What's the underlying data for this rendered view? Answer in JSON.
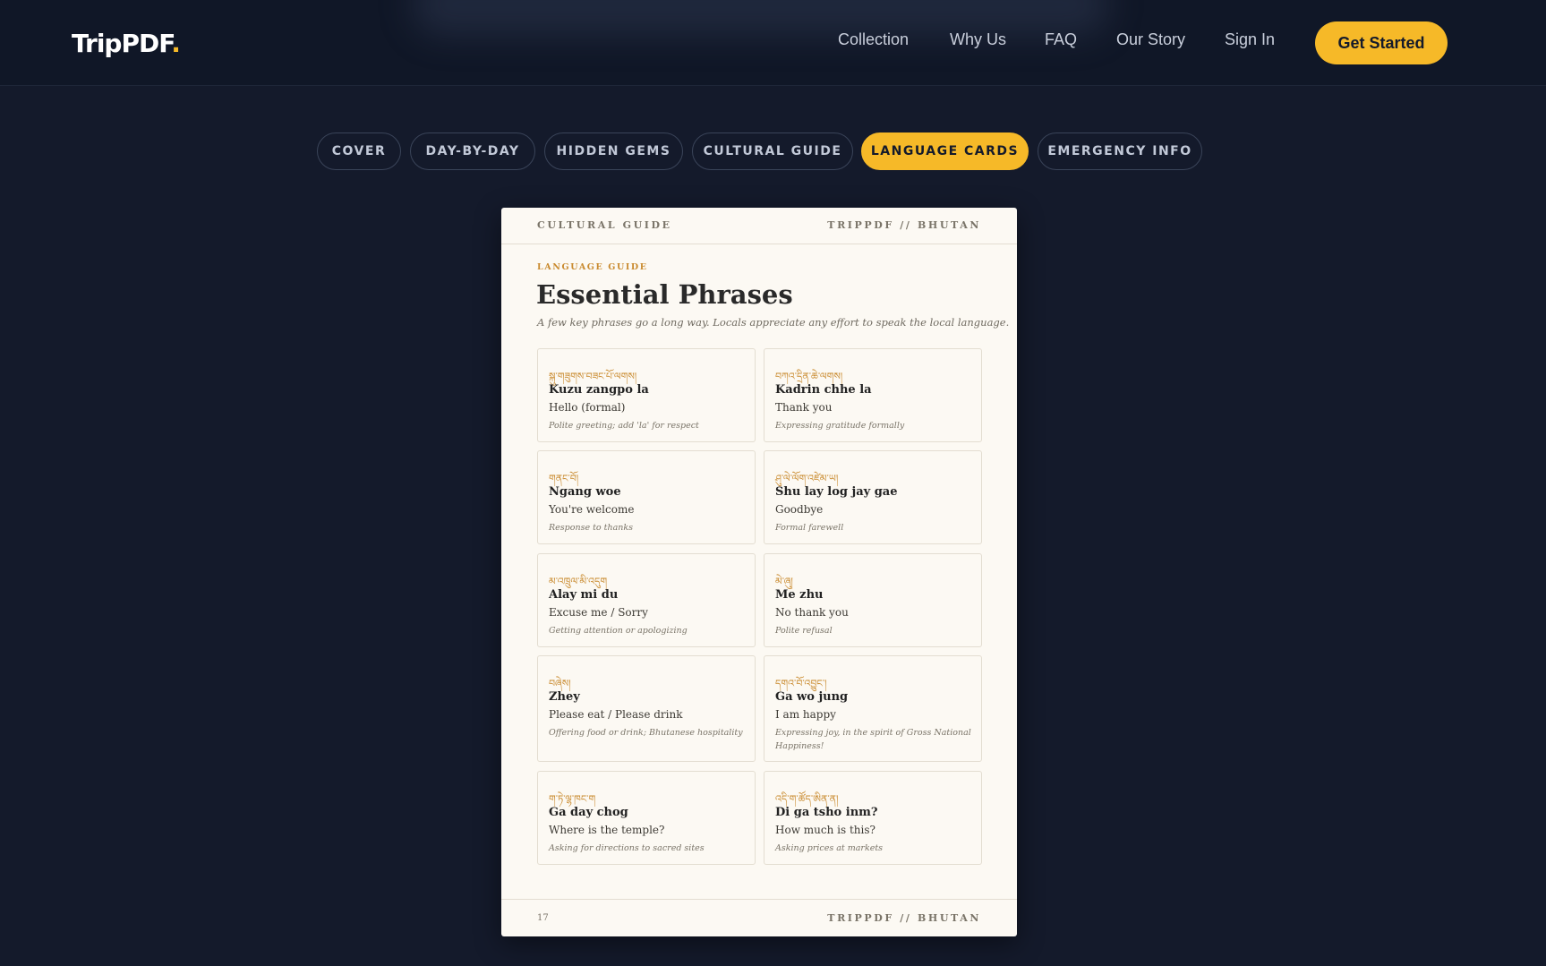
{
  "brand": {
    "name": "TripPDF",
    "dot": "."
  },
  "nav": {
    "links": [
      "Collection",
      "Why Us",
      "FAQ",
      "Our Story",
      "Sign In"
    ],
    "cta": "Get Started"
  },
  "tabs": [
    {
      "label": "COVER",
      "active": false
    },
    {
      "label": "DAY-BY-DAY",
      "active": false
    },
    {
      "label": "HIDDEN GEMS",
      "active": false
    },
    {
      "label": "CULTURAL GUIDE",
      "active": false
    },
    {
      "label": "LANGUAGE CARDS",
      "active": true
    },
    {
      "label": "EMERGENCY INFO",
      "active": false
    }
  ],
  "page": {
    "header_left": "CULTURAL GUIDE",
    "header_right": "TRIPPDF // BHUTAN",
    "eyebrow": "LANGUAGE GUIDE",
    "title": "Essential Phrases",
    "subtitle": "A few key phrases go a long way. Locals appreciate any effort to speak the local language.",
    "phrases": [
      {
        "dzongkha": "སྐུ་གཟུགས་བཟང་པོ་ལགས།",
        "roman": "Kuzu zangpo la",
        "meaning": "Hello (formal)",
        "note": "Polite greeting; add 'la' for respect"
      },
      {
        "dzongkha": "བཀའ་དྲིན་ཆེ་ལགས།",
        "roman": "Kadrin chhe la",
        "meaning": "Thank you",
        "note": "Expressing gratitude formally"
      },
      {
        "dzongkha": "གནང་བོ།",
        "roman": "Ngang woe",
        "meaning": "You're welcome",
        "note": "Response to thanks"
      },
      {
        "dzongkha": "ཤུ་ལེ་ལོག་འཛེམ་ཡ།",
        "roman": "Shu lay log jay gae",
        "meaning": "Goodbye",
        "note": "Formal farewell"
      },
      {
        "dzongkha": "མ་འཁྲུལ་མི་འདུག",
        "roman": "Alay mi du",
        "meaning": "Excuse me / Sorry",
        "note": "Getting attention or apologizing"
      },
      {
        "dzongkha": "མེ་ཞུ།",
        "roman": "Me zhu",
        "meaning": "No thank you",
        "note": "Polite refusal"
      },
      {
        "dzongkha": "བཞེས།",
        "roman": "Zhey",
        "meaning": "Please eat / Please drink",
        "note": "Offering food or drink; Bhutanese hospitality"
      },
      {
        "dzongkha": "དགའ་བོ་འབྱུང་།",
        "roman": "Ga wo jung",
        "meaning": "I am happy",
        "note": "Expressing joy, in the spirit of Gross National Happiness!"
      },
      {
        "dzongkha": "ག་ཏེ་ལྷ་ཁང་ག",
        "roman": "Ga day chog",
        "meaning": "Where is the temple?",
        "note": "Asking for directions to sacred sites"
      },
      {
        "dzongkha": "འདི་ག་ཚོད་ཨིན་ན།",
        "roman": "Di ga tsho inm?",
        "meaning": "How much is this?",
        "note": "Asking prices at markets"
      }
    ],
    "page_number": "17",
    "footer_right": "TRIPPDF // BHUTAN"
  }
}
